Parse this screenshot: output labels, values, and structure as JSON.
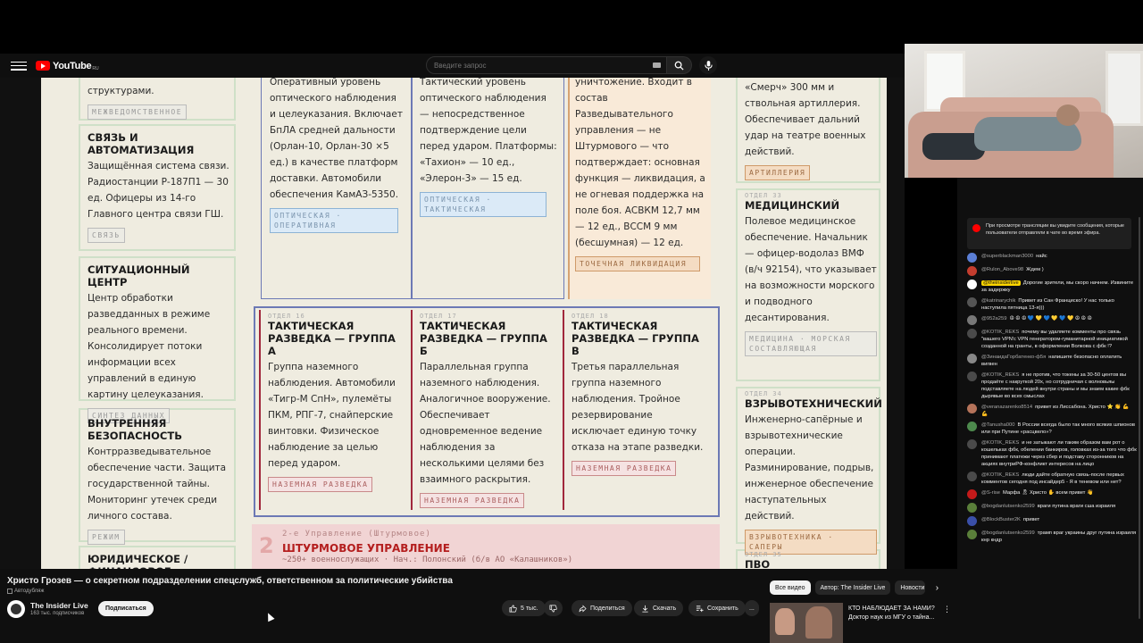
{
  "masthead": {
    "logo_text": "YouTube",
    "logo_region": "RU",
    "search_placeholder": "Введите запрос"
  },
  "slide": {
    "cards": [
      {
        "num": "",
        "title": "",
        "body": "структурами.",
        "tag": "МЕЖВЕДОМСТВЕННОЕ"
      },
      {
        "num": "",
        "title": "СВЯЗЬ И АВТОМАТИЗАЦИЯ",
        "body": "Защищённая система связи. Радиостанции Р-187П1 — 30 ед. Офицеры из 14-го Главного центра связи ГШ.",
        "tag": "СВЯЗЬ"
      },
      {
        "num": "",
        "title": "СИТУАЦИОННЫЙ ЦЕНТР",
        "body": "Центр обработки разведданных в режиме реального времени. Консолидирует потоки информации всех управлений в единую картину целеуказания.",
        "tag": "СИНТЕЗ ДАННЫХ"
      },
      {
        "num": "",
        "title": "ВНУТРЕННЯЯ БЕЗОПАСНОСТЬ",
        "body": "Контрразведывательное обеспечение части. Защита государственной тайны. Мониторинг утечек среди личного состава.",
        "tag": "РЕЖИМ"
      },
      {
        "num": "",
        "title": "ЮРИДИЧЕСКОЕ / ФИНАНСОВОЕ УПРАВЛЕНИЕ",
        "body": "",
        "tag": ""
      },
      {
        "num": "",
        "title": "",
        "body": "Оперативный уровень оптического наблюдения и целеуказания. Включает БпЛА средней дальности (Орлан-10, Орлан-30 ×5 ед.) в качестве платформ доставки. Автомобили обеспечения КамАЗ-5350.",
        "tag": "ОПТИЧЕСКАЯ · ОПЕРАТИВНАЯ"
      },
      {
        "num": "",
        "title": "",
        "body": "Тактический уровень оптического наблюдения — непосредственное подтверждение цели перед ударом. Платформы: «Тахион» — 10 ед., «Элерон-3» — 15 ед.",
        "tag": "ОПТИЧЕСКАЯ · ТАКТИЧЕСКАЯ"
      },
      {
        "num": "",
        "title": "",
        "body": "уничтожение. Входит в состав Разведывательного управления — не Штурмового — что подтверждает: основная функция — ликвидация, а не огневая поддержка на поле боя. АСВКМ 12,7 мм — 12 ед., ВССМ 9 мм (бесшумная) — 12 ед.",
        "tag": "ТОЧЕЧНАЯ ЛИКВИДАЦИЯ"
      },
      {
        "num": "ОТДЕЛ 16",
        "title": "ТАКТИЧЕСКАЯ РАЗВЕДКА — ГРУППА А",
        "body": "Группа наземного наблюдения. Автомобили «Тигр-М СпН», пулемёты ПКМ, РПГ-7, снайперские винтовки. Физическое наблюдение за целью перед ударом.",
        "tag": "НАЗЕМНАЯ РАЗВЕДКА"
      },
      {
        "num": "ОТДЕЛ 17",
        "title": "ТАКТИЧЕСКАЯ РАЗВЕДКА — ГРУППА Б",
        "body": "Параллельная группа наземного наблюдения. Аналогичное вооружение. Обеспечивает одновременное ведение наблюдения за несколькими целями без взаимного раскрытия.",
        "tag": "НАЗЕМНАЯ РАЗВЕДКА"
      },
      {
        "num": "ОТДЕЛ 18",
        "title": "ТАКТИЧЕСКАЯ РАЗВЕДКА — ГРУППА В",
        "body": "Третья параллельная группа наземного наблюдения. Тройное резервирование исключает единую точку отказа на этапе разведки.",
        "tag": "НАЗЕМНАЯ РАЗВЕДКА"
      },
      {
        "num": "",
        "title": "",
        "body": "«Смерч» 300 мм и ствольная артиллерия. Обеспечивает дальний удар на театре военных действий.",
        "tag": "АРТИЛЛЕРИЯ"
      },
      {
        "num": "ОТДЕЛ 33",
        "title": "МЕДИЦИНСКИЙ",
        "body": "Полевое медицинское обеспечение. Начальник — офицер-водолаз ВМФ (в/ч 92154), что указывает на возможности морского и подводного десантирования.",
        "tag": "МЕДИЦИНА · МОРСКАЯ СОСТАВЛЯЮЩАЯ"
      },
      {
        "num": "ОТДЕЛ 34",
        "title": "ВЗРЫВОТЕХНИЧЕСКИЙ",
        "body": "Инженерно-сапёрные и взрывотехнические операции. Разминирование, подрыв, инженерное обеспечение наступательных действий.",
        "tag": "ВЗРЫВОТЕХНИКА · САПЕРЫ"
      },
      {
        "num": "ОТДЕЛ 35",
        "title": "ПВО",
        "body": "",
        "tag": ""
      }
    ],
    "shturm": {
      "num": "2",
      "header": "2-е Управление (Штурмовое)",
      "title": "ШТУРМОВОЕ УПРАВЛЕНИЕ",
      "sub": "~250+ военнослужащих · Нач.: Полонский (б/в АО «Калашников»)"
    }
  },
  "video_info": {
    "title": "Христо Грозев — о секретном подразделении спецслужб, ответственном за политические убийства",
    "autodub": "Автодубляж",
    "channel_name": "The Insider Live",
    "subscribers": "163 тыс. подписчиков",
    "subscribe_label": "Подписаться",
    "likes": "5 тыс.",
    "share_label": "Поделиться",
    "download_label": "Скачать",
    "save_label": "Сохранить",
    "more_label": "..."
  },
  "chips": {
    "all": "Все видео",
    "author": "Автор: The Insider Live",
    "news": "Новости"
  },
  "recommended": {
    "title": "КТО НАБЛЮДАЕТ ЗА НАМИ? Доктор наук из МГУ о тайна..."
  },
  "chat": {
    "notice": "При просмотре трансляции вы увидите сообщения, которые пользователи отправляли в чате во время эфира.",
    "messages": [
      {
        "author": "@superblackman3000",
        "text": "найс",
        "color": "#5b7fd6",
        "owner": false
      },
      {
        "author": "@Rulon_Above98",
        "text": "Ждем )",
        "color": "#c43d2e",
        "owner": false
      },
      {
        "author": "@theinsiderlive",
        "text": "Дорогие зрители, мы скоро начнем. Извините за задержку",
        "color": "#ffffff",
        "owner": true
      },
      {
        "author": "@katrinarychik",
        "text": "Привет из Сан Франциско! У нас только наступила пятница 13-я)))",
        "color": "#555555",
        "owner": false
      },
      {
        "author": "@952a259",
        "text": "☮ ☮ ☮ 💙 💛 💙 💛 💙 💛 ☮ ☮ ☮",
        "color": "#777777",
        "owner": false
      },
      {
        "author": "@KOTIK_REKS",
        "text": "почему вы удаляете комменты про связь \"вашего VPN'с VPN генератором-гуманитарной инициативой созданной на гранты, в оформлении Волкова с фбк !?",
        "color": "#4a4a4a",
        "owner": false
      },
      {
        "author": "@ЗинаидаГорбатенко-ф5я",
        "text": "напишите безопасно оплатить вигвен",
        "color": "#888888",
        "owner": false
      },
      {
        "author": "@KOTIK_REKS",
        "text": "я не против, что токены за 30-50 центов вы продаёте с накруткой 20х, но сотрудничая с волновьяы подставляете на людей внутри страны и мы знаем какие фбк дырявые во всех смыслах",
        "color": "#4a4a4a",
        "owner": false
      },
      {
        "author": "@veranazarenko8514",
        "text": "привет из Лиссабона. Христо ⭐ 👏 💪 💪",
        "color": "#b5735a",
        "owner": false
      },
      {
        "author": "@Tanusha000",
        "text": "В России всегда было так много всяких шпионов или при Путине «расцвело»?",
        "color": "#4d8a4d",
        "owner": false
      },
      {
        "author": "@KOTIK_REKS",
        "text": "и не затыкают ли таким образом вам рот о кошельках фбк, обелении банкиров, головках из-за того что фбк принимают платежи через сбер и подставу сторонников на акциях внутриРФ-конфликт интересов на лицо",
        "color": "#4a4a4a",
        "owner": false
      },
      {
        "author": "@KOTIK_REKS",
        "text": "люди дайте обратную связь-после первых комментов сегодня под инсайдер5 - Я в теневом или нет?",
        "color": "#4a4a4a",
        "owner": false
      },
      {
        "author": "@S-rise",
        "text": "Марфа 🎗 Христо ✋ всем привет 👋",
        "color": "#c41a1a",
        "owner": false
      },
      {
        "author": "@bogdanlutsenko2599",
        "text": "враги путина враги сша израиля",
        "color": "#5a7f3a",
        "owner": false
      },
      {
        "author": "@BlockBuster2K",
        "text": "привет",
        "color": "#3a4fa8",
        "owner": false
      },
      {
        "author": "@bogdanlutsenko2599",
        "text": "трамп враг украины друг путина израиля кнр кндр",
        "color": "#5a7f3a",
        "owner": false
      }
    ]
  }
}
